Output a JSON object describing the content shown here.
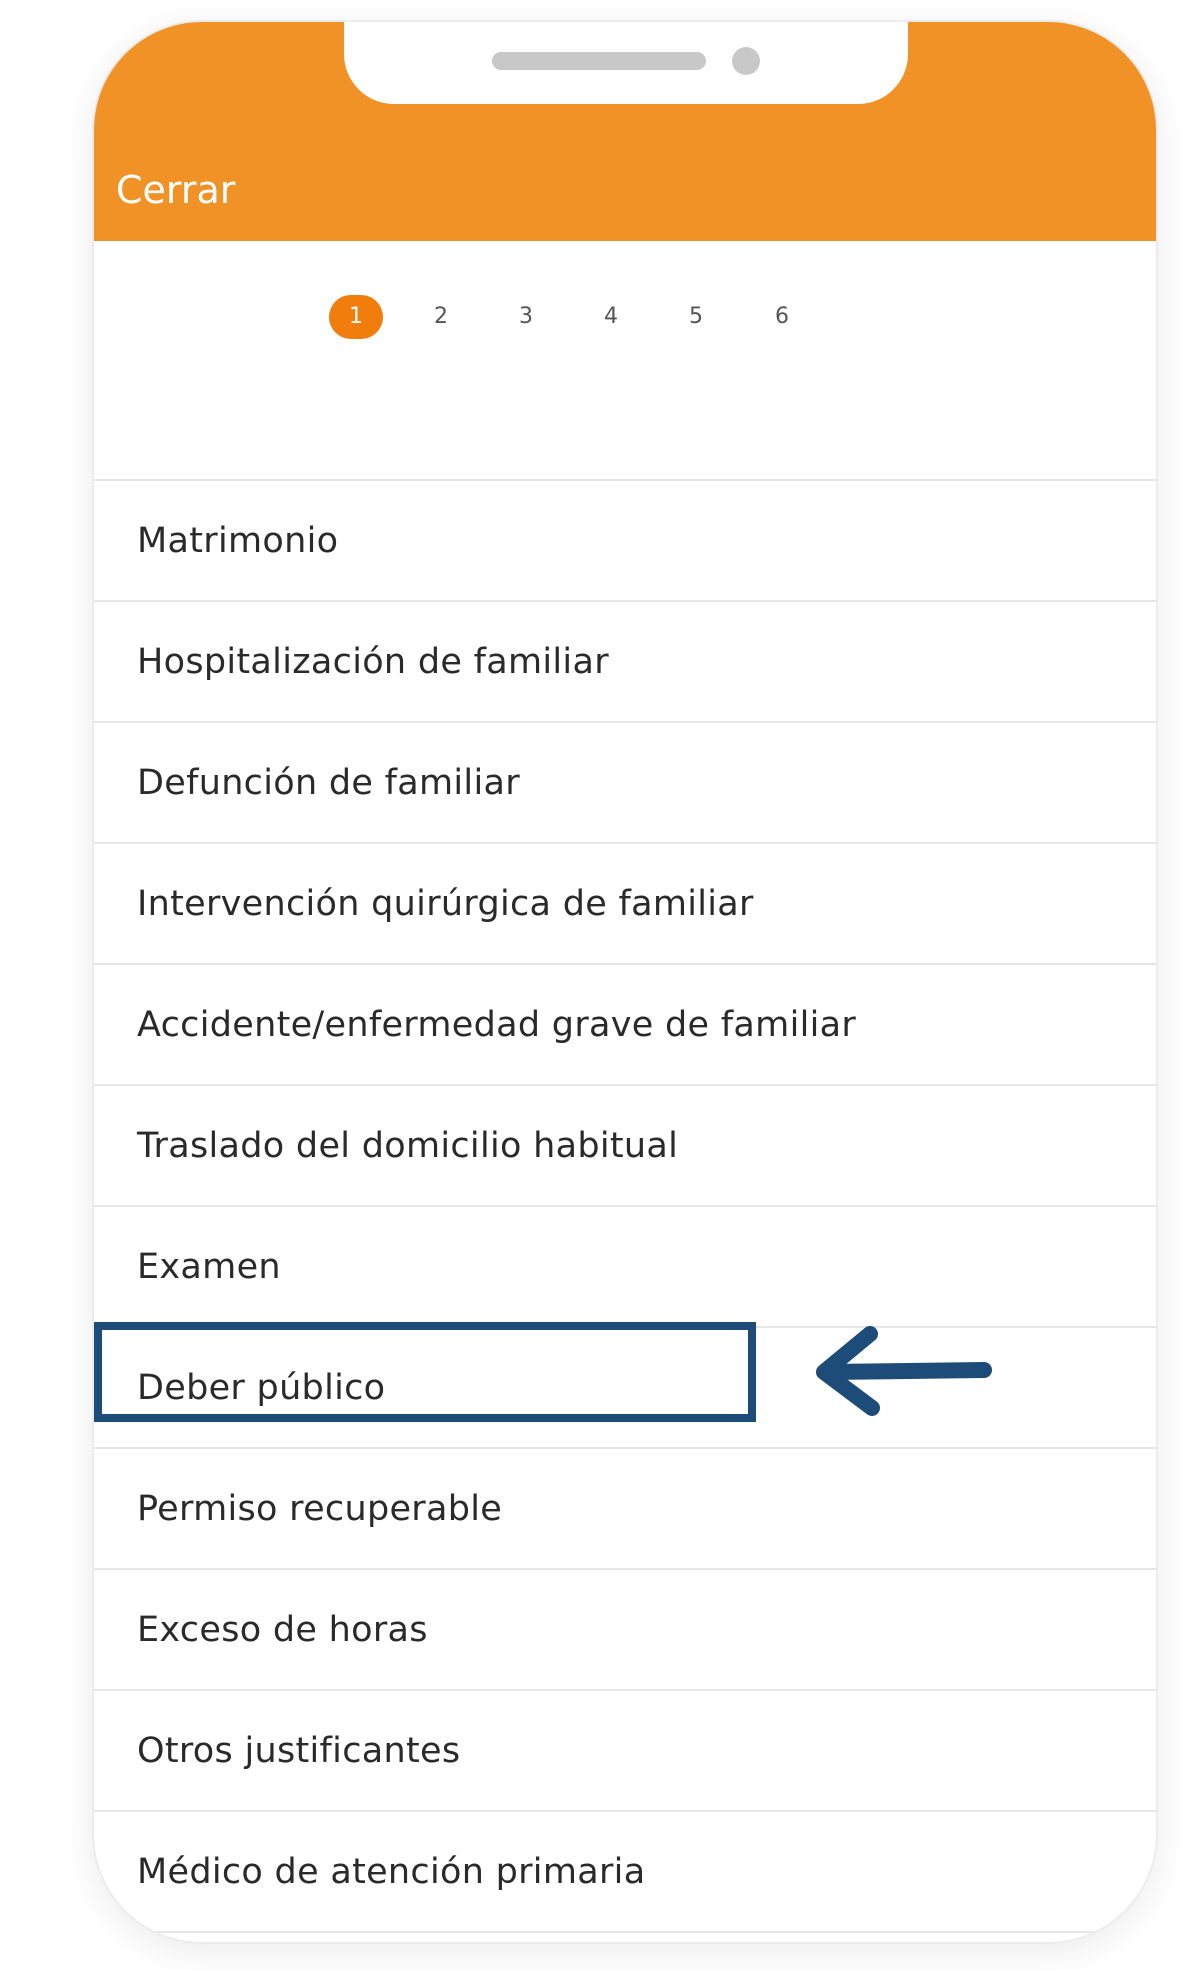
{
  "header": {
    "close_label": "Cerrar",
    "color": "#f09226"
  },
  "steps": {
    "items": [
      "1",
      "2",
      "3",
      "4",
      "5",
      "6"
    ],
    "active": "1",
    "active_color": "#f07d0c"
  },
  "list": {
    "items": [
      "Matrimonio",
      "Hospitalización de familiar",
      "Defunción de familiar",
      "Intervención quirúrgica de familiar",
      "Accidente/enfermedad grave de familiar",
      "Traslado del domicilio habitual",
      "Examen",
      "Deber público",
      "Permiso recuperable",
      "Exceso de horas",
      "Otros justificantes",
      "Médico de atención primaria"
    ],
    "highlighted": "Deber público"
  },
  "annotation": {
    "color": "#1d4c79",
    "arrow_icon": "left-arrow-icon"
  }
}
